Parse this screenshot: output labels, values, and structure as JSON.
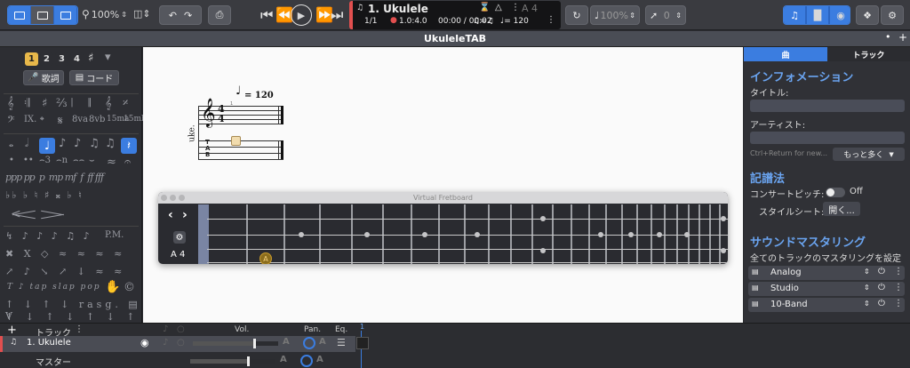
{
  "toolbar": {
    "zoom": "100%",
    "song_title": "1. Ukulele",
    "bar_position": "1/1",
    "beat_position": "1.0:4.0",
    "time": "00:00 / 00:02",
    "tempo_lcd": "♩= 120",
    "swing_label": "♫=♫",
    "key_label": "A 4",
    "speed": "100%",
    "capo": "0"
  },
  "tab_title": "UkuleleTAB",
  "left_panel": {
    "voices": [
      "1",
      "2",
      "3",
      "4"
    ],
    "lyrics_button": "歌詞",
    "chord_button": "コード"
  },
  "score": {
    "tempo_marking": "= 120",
    "track_label": "uke.",
    "time_sig_top": "4",
    "time_sig_bottom": "4",
    "tab_letters": "T\nA\nB"
  },
  "fretboard": {
    "title": "Virtual Fretboard",
    "note_label": "A 4",
    "marker": "A"
  },
  "right_panel": {
    "tab_song": "曲",
    "tab_track": "トラック",
    "info_heading": "インフォメーション",
    "title_label": "タイトル:",
    "artist_label": "アーティスト:",
    "ctrl_hint": "Ctrl+Return for new...",
    "more_button": "もっと多く",
    "notation_heading": "記譜法",
    "concert_pitch_label": "コンサートピッチ:",
    "concert_pitch_value": "Off",
    "stylesheet_label": "スタイルシート:",
    "stylesheet_button": "開く...",
    "mastering_heading": "サウンドマスタリング",
    "mastering_sub": "全てのトラックのマスタリングを設定",
    "presets": [
      "Analog",
      "Studio",
      "10-Band"
    ]
  },
  "mixer": {
    "track_header": "トラック",
    "vol": "Vol.",
    "pan": "Pan.",
    "eq": "Eq.",
    "track_num": "1",
    "track_name": "1. Ukulele",
    "master": "マスター"
  }
}
